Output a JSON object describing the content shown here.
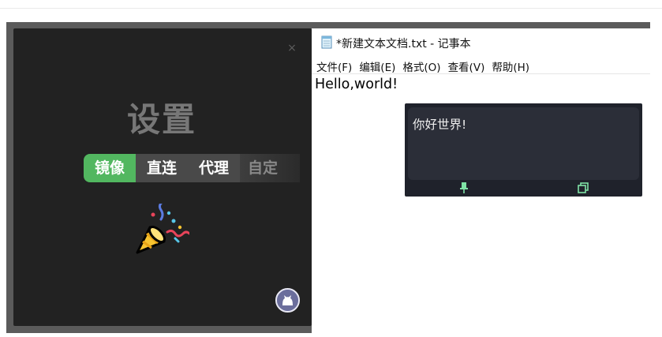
{
  "settings_panel": {
    "title": "设置",
    "close_glyph": "×",
    "tabs": [
      {
        "label": "镜像",
        "active": true
      },
      {
        "label": "直连",
        "active": false
      },
      {
        "label": "代理",
        "active": false
      },
      {
        "label": "自定",
        "active": false
      }
    ],
    "icons": [
      "close-icon",
      "party-popper-icon",
      "github-icon"
    ],
    "accent_color": "#52b760",
    "background_color": "#222222"
  },
  "notepad": {
    "title": "*新建文本文档.txt - 记事本",
    "menu": [
      "文件(F)",
      "编辑(E)",
      "格式(O)",
      "查看(V)",
      "帮助(H)"
    ],
    "content": "Hello,world!"
  },
  "translation_popup": {
    "text": "你好世界!",
    "icons": [
      "pin-icon",
      "copy-icon"
    ],
    "icon_color": "#7fe3a6"
  }
}
